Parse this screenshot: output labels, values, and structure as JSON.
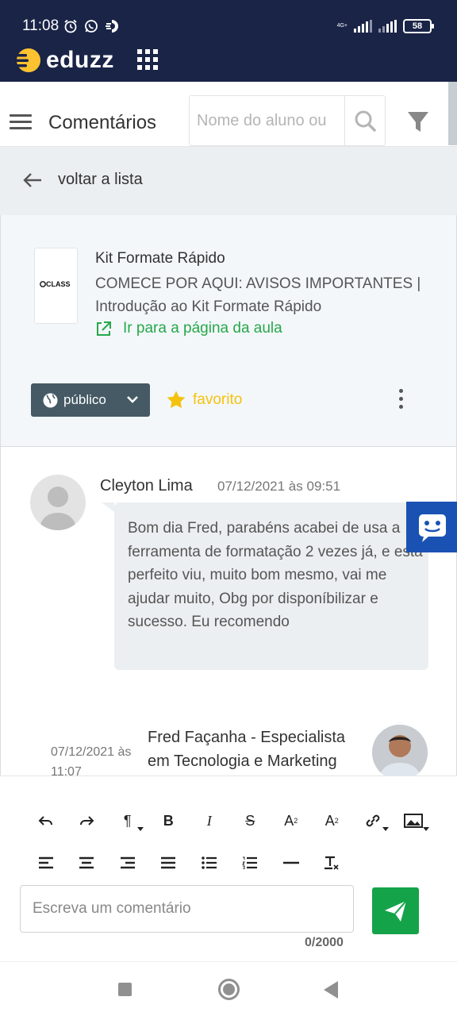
{
  "status_bar": {
    "time": "11:08",
    "network": "4G+",
    "battery": "58",
    "icons": [
      "alarm-icon",
      "whatsapp-icon",
      "app-notification-icon",
      "signal-icon",
      "battery-icon"
    ]
  },
  "app_bar": {
    "brand": "eduzz",
    "icons": [
      "eduzz-logo",
      "apps-grid-icon"
    ]
  },
  "toolbar": {
    "title": "Comentários",
    "search_placeholder": "Nome do aluno ou",
    "icons": [
      "menu-icon",
      "search-icon",
      "filter-icon"
    ]
  },
  "back": {
    "label": "voltar a lista"
  },
  "lesson": {
    "thumbnail_text": "CLASS",
    "course": "Kit Formate Rápido",
    "path": "COMECE POR AQUI: AVISOS IMPORTANTES | Introdução ao Kit Formate Rápido",
    "link": "Ir para a página da aula",
    "visibility": "público",
    "favorite": "favorito"
  },
  "comments": [
    {
      "author": "Cleyton Lima",
      "date": "07/12/2021 às 09:51",
      "text": "Bom dia Fred, parabéns acabei de usa a ferramenta de formatação 2 vezes já, e está perfeito viu, muito bom mesmo, vai me ajudar muito, Obg por disponíbilizar e sucesso. Eu recomendo"
    },
    {
      "author": "Fred Façanha - Especialista em Tecnologia e Marketing",
      "date": "07/12/2021 às 11:07"
    }
  ],
  "editor": {
    "toolbar_row1": [
      "undo-icon",
      "redo-icon",
      "paragraph-icon",
      "bold-icon",
      "italic-icon",
      "strikethrough-icon",
      "superscript-icon",
      "subscript-icon",
      "link-icon",
      "image-icon"
    ],
    "toolbar_row2": [
      "align-left-icon",
      "align-center-icon",
      "align-right-icon",
      "align-justify-icon",
      "bullet-list-icon",
      "numbered-list-icon",
      "horizontal-rule-icon",
      "clear-format-icon"
    ],
    "placeholder": "Escreva um comentário",
    "counter": "0/2000"
  },
  "colors": {
    "header": "#1a2447",
    "brand_yellow": "#fdc22f",
    "green": "#15a34a",
    "link_green": "#27a84a",
    "favorite": "#f4c20d",
    "chat_widget": "#1a52b4",
    "public_button": "#455a64"
  }
}
